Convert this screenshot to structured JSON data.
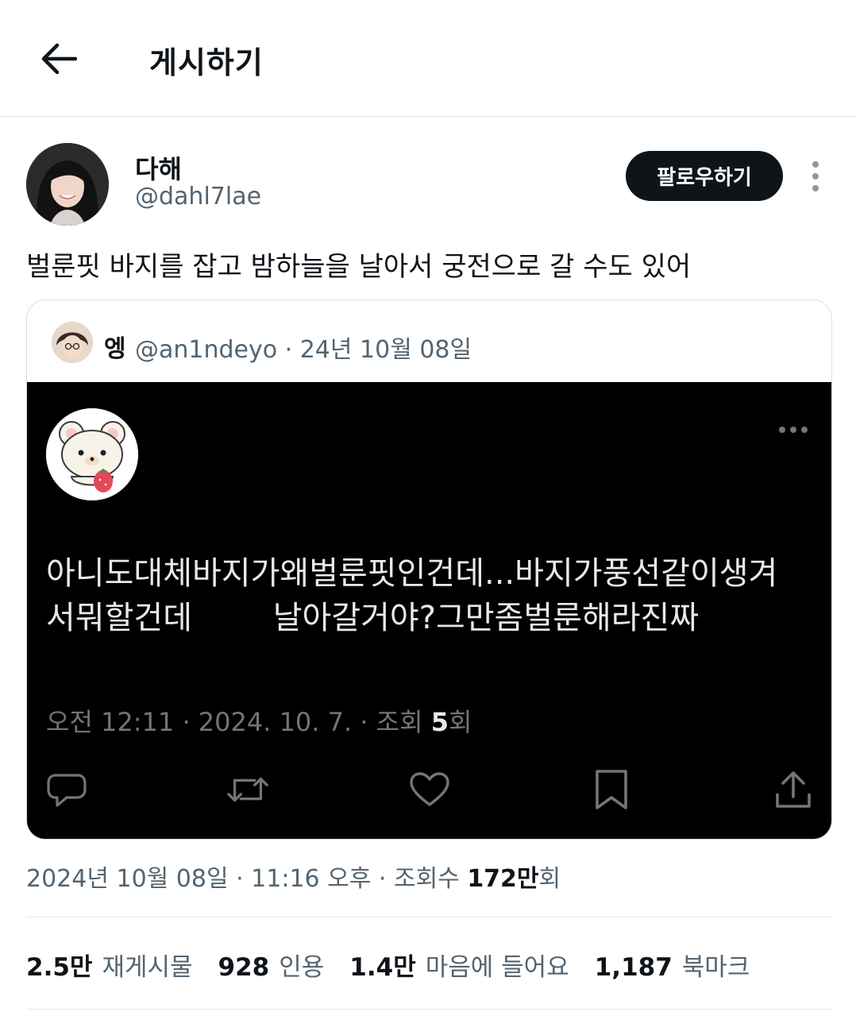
{
  "header": {
    "title": "게시하기"
  },
  "author": {
    "name": "다해",
    "handle": "@dahl7lae"
  },
  "follow_label": "팔로우하기",
  "tweet": {
    "text": "벌룬핏 바지를 잡고 밤하늘을 날아서 궁전으로 갈 수도 있어"
  },
  "quote": {
    "name": "엥",
    "meta": "@an1ndeyo · 24년 10월 08일",
    "image": {
      "text_line1": "아니도대체바지가왜벌룬핏인건데...바지가풍선같이생겨",
      "text_line2": "서뭐할건데        날아갈거야?그만좀벌룬해라진짜",
      "meta_prefix": "오전 12:11 · 2024. 10. 7. · 조회 ",
      "views": "5",
      "meta_suffix": "회"
    }
  },
  "timestamp": {
    "prefix": "2024년 10월 08일 · 11:16 오후 · 조회수 ",
    "views": "172만",
    "suffix": "회"
  },
  "stats": [
    {
      "num": "2.5만",
      "label": "재게시물"
    },
    {
      "num": "928",
      "label": "인용"
    },
    {
      "num": "1.4만",
      "label": "마음에 들어요"
    },
    {
      "num": "1,187",
      "label": "북마크"
    }
  ],
  "colors": {
    "text": "#0f1419",
    "secondary": "#536471",
    "button_bg": "#0f1419",
    "image_bg": "#000000"
  },
  "icons": [
    "back-arrow-icon",
    "more-vertical-icon",
    "reply-icon",
    "repost-icon",
    "like-icon",
    "bookmark-icon",
    "share-icon"
  ]
}
